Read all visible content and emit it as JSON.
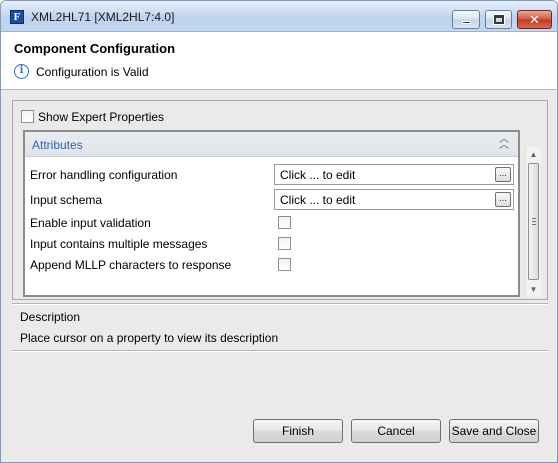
{
  "window": {
    "app_icon_letter": "F",
    "title": "XML2HL71 [XML2HL7:4.0]",
    "close_glyph": "✕"
  },
  "header": {
    "title": "Component Configuration",
    "status_text": "Configuration is Valid"
  },
  "content": {
    "show_expert_label": "Show Expert Properties",
    "show_expert_checked": false,
    "group_title": "Attributes",
    "properties": [
      {
        "label": "Error handling configuration",
        "value": "Click ... to edit",
        "button": "...",
        "type": "editor"
      },
      {
        "label": "Input schema",
        "value": "Click ... to edit",
        "button": "...",
        "type": "editor"
      },
      {
        "label": "Enable input validation",
        "type": "checkbox",
        "checked": false
      },
      {
        "label": "Input contains multiple messages",
        "type": "checkbox",
        "checked": false
      },
      {
        "label": "Append MLLP characters to response",
        "type": "checkbox",
        "checked": false
      }
    ]
  },
  "description": {
    "title": "Description",
    "text": "Place cursor on a property to view its description"
  },
  "buttons": {
    "finish": "Finish",
    "cancel": "Cancel",
    "save_close": "Save and Close"
  },
  "icons": {
    "info": "i",
    "collapse": "chevron-double-up-icon",
    "scroll_up": "▲",
    "scroll_down": "▼"
  }
}
